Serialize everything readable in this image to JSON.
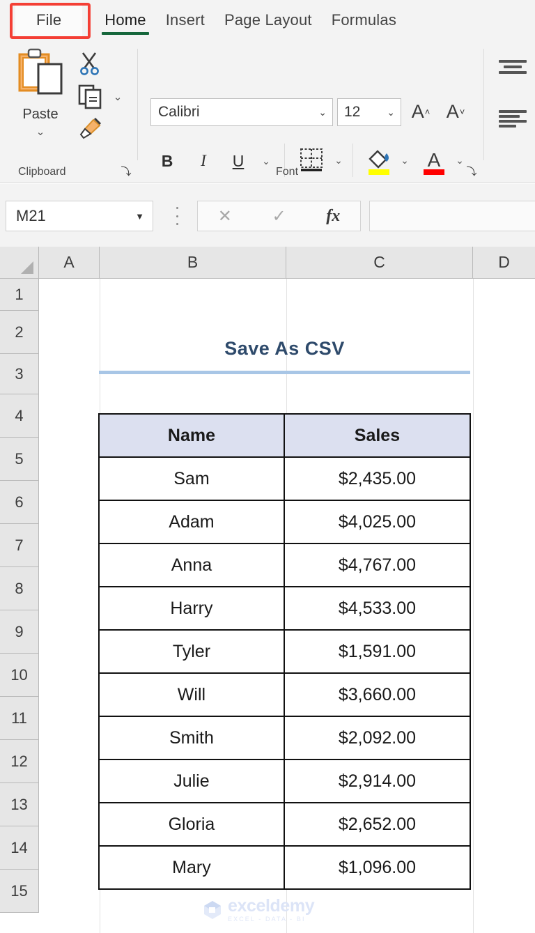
{
  "ribbon": {
    "tabs": [
      {
        "label": "File",
        "icon": "file-tab"
      },
      {
        "label": "Home",
        "icon": "home-tab"
      },
      {
        "label": "Insert",
        "icon": "insert-tab"
      },
      {
        "label": "Page Layout",
        "icon": "page-layout-tab"
      },
      {
        "label": "Formulas",
        "icon": "formulas-tab"
      }
    ],
    "active_tab": "Home",
    "highlighted_tab": "File",
    "highlight_color": "#f43f35",
    "active_underline_color": "#15663b",
    "groups": [
      {
        "label": "Clipboard"
      },
      {
        "label": "Font"
      }
    ],
    "clipboard": {
      "paste_label": "Paste",
      "paste_caret": "⌄",
      "cut_icon": "scissors-icon",
      "copy_icon": "copy-icon",
      "copy_caret": "⌄",
      "format_painter_icon": "paintbrush-icon",
      "dialog_launcher": "⤵"
    },
    "font": {
      "font_name_value": "Calibri",
      "font_size_value": "12",
      "dropdown_caret": "⌄",
      "grow_font_label": "A",
      "shrink_font_label": "A",
      "grow_font_mark": "˄",
      "shrink_font_mark": "˅",
      "bold_label": "B",
      "italic_label": "I",
      "underline_label": "U",
      "underline_caret": "⌄",
      "borders_caret": "⌄",
      "fill_caret": "⌄",
      "fontcolor_label": "A",
      "fontcolor_caret": "⌄",
      "fill_color": "#ffff00",
      "font_color": "#ff0000",
      "dialog_launcher": "⤵"
    },
    "alignment": {
      "top_align_icon": "top-align-icon",
      "left_align_icon": "align-left-icon"
    }
  },
  "formula_bar": {
    "name_box_value": "M21",
    "name_box_caret": "▼",
    "cancel_label": "✕",
    "enter_label": "✓",
    "fx_label": "fx",
    "formula_value": "",
    "formula_placeholder": ""
  },
  "grid": {
    "columns": [
      "A",
      "B",
      "C",
      "D"
    ],
    "rows": [
      "1",
      "2",
      "3",
      "4",
      "5",
      "6",
      "7",
      "8",
      "9",
      "10",
      "11",
      "12",
      "13",
      "14",
      "15"
    ],
    "select_all_icon": "select-all-triangle-icon"
  },
  "sheet": {
    "title": "Save As CSV",
    "title_color": "#2e4a6b",
    "title_rule_color": "#a8c6e6",
    "table": {
      "header_fill": "#dce0f0",
      "headers": [
        "Name",
        "Sales"
      ],
      "rows": [
        [
          "Sam",
          "$2,435.00"
        ],
        [
          "Adam",
          "$4,025.00"
        ],
        [
          "Anna",
          "$4,767.00"
        ],
        [
          "Harry",
          "$4,533.00"
        ],
        [
          "Tyler",
          "$1,591.00"
        ],
        [
          "Will",
          "$3,660.00"
        ],
        [
          "Smith",
          "$2,092.00"
        ],
        [
          "Julie",
          "$2,914.00"
        ],
        [
          "Gloria",
          "$2,652.00"
        ],
        [
          "Mary",
          "$1,096.00"
        ]
      ]
    }
  },
  "watermark": {
    "name": "exceldemy",
    "tagline": "EXCEL - DATA - BI",
    "icon": "exceldemy-cube-logo"
  }
}
